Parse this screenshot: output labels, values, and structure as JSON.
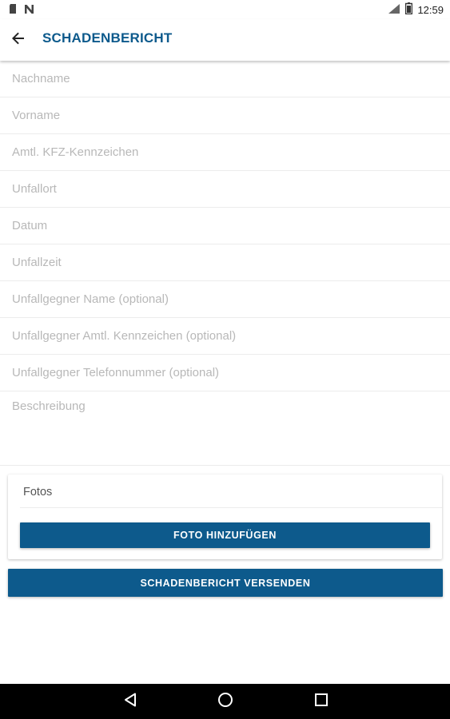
{
  "status_bar": {
    "time": "12:59",
    "left_icons": [
      "sim-card-icon",
      "notification-n-icon"
    ],
    "right_icons": [
      "signal-icon",
      "battery-icon"
    ]
  },
  "app_bar": {
    "back_icon": "arrow-back-icon",
    "title": "SCHADENBERICHT",
    "accent_color": "#0d5a8c"
  },
  "form": {
    "fields": [
      {
        "placeholder": "Nachname",
        "value": ""
      },
      {
        "placeholder": "Vorname",
        "value": ""
      },
      {
        "placeholder": "Amtl. KFZ-Kennzeichen",
        "value": ""
      },
      {
        "placeholder": "Unfallort",
        "value": ""
      },
      {
        "placeholder": "Datum",
        "value": ""
      },
      {
        "placeholder": "Unfallzeit",
        "value": ""
      },
      {
        "placeholder": "Unfallgegner Name (optional)",
        "value": ""
      },
      {
        "placeholder": "Unfallgegner Amtl. Kennzeichen (optional)",
        "value": ""
      },
      {
        "placeholder": "Unfallgegner Telefonnummer (optional)",
        "value": ""
      }
    ],
    "description": {
      "placeholder": "Beschreibung",
      "value": ""
    }
  },
  "photos": {
    "label": "Fotos",
    "add_button": "FOTO HINZUFÜGEN"
  },
  "send_button": "SCHADENBERICHT VERSENDEN",
  "nav_bar": {
    "icons": [
      "nav-back-icon",
      "nav-home-icon",
      "nav-recents-icon"
    ]
  }
}
